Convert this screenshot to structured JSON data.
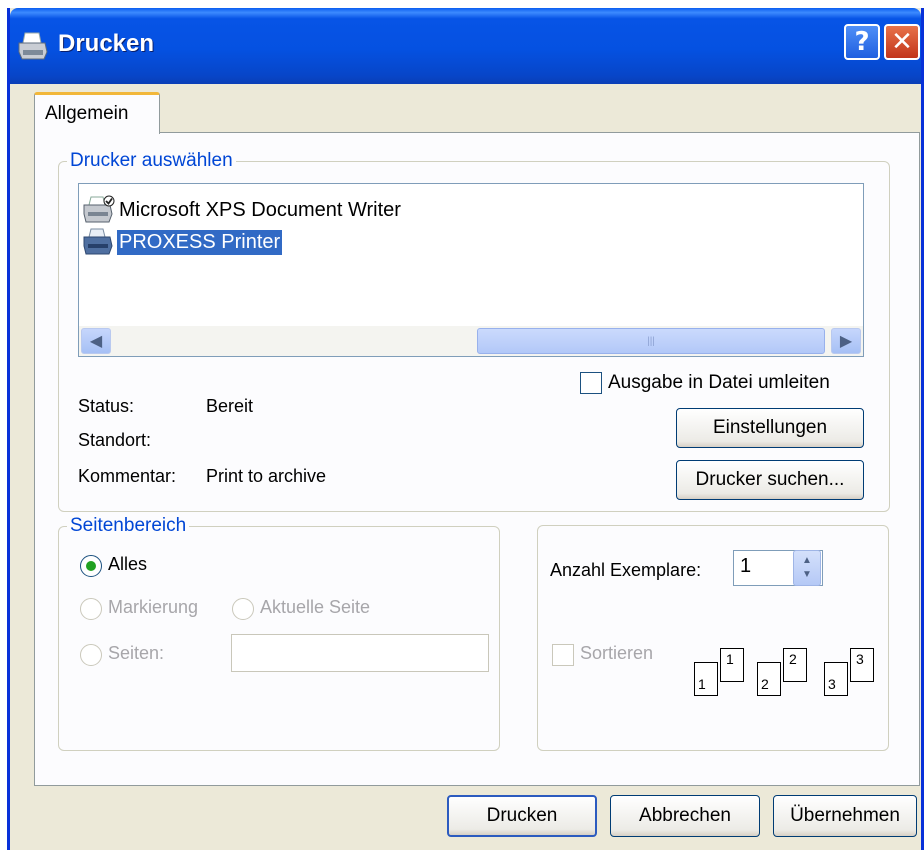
{
  "window": {
    "title": "Drucken",
    "help_button": "?",
    "close_button": "✕"
  },
  "tabs": [
    {
      "label": "Allgemein",
      "selected": true
    }
  ],
  "printer_group": {
    "legend": "Drucker auswählen",
    "printers": [
      {
        "name": "Microsoft XPS Document Writer",
        "icon": "printer-default-icon",
        "selected": false
      },
      {
        "name": "PROXESS Printer",
        "icon": "printer-icon",
        "selected": true
      }
    ],
    "scrollbar": {
      "left_arrow": "◀",
      "right_arrow": "▶",
      "thumb_grip": "|||"
    },
    "output_to_file_label": "Ausgabe in Datei umleiten",
    "output_to_file_checked": false,
    "status_label": "Status:",
    "status_value": "Bereit",
    "location_label": "Standort:",
    "location_value": "",
    "comment_label": "Kommentar:",
    "comment_value": "Print to archive",
    "settings_button": "Einstellungen",
    "find_printer_button": "Drucker suchen..."
  },
  "page_range": {
    "legend": "Seitenbereich",
    "all_label": "Alles",
    "selection_label": "Markierung",
    "current_page_label": "Aktuelle Seite",
    "pages_label": "Seiten:",
    "pages_value": "",
    "selected_option": "all"
  },
  "copies": {
    "count_label": "Anzahl Exemplare:",
    "count_value": "1",
    "collate_label": "Sortieren",
    "collate_checked": false,
    "collate_sets": [
      {
        "back": "1",
        "front": "1"
      },
      {
        "back": "2",
        "front": "2"
      },
      {
        "back": "3",
        "front": "3"
      }
    ]
  },
  "buttons": {
    "print": "Drucken",
    "cancel": "Abbrechen",
    "apply": "Übernehmen"
  },
  "colors": {
    "titlebar": "#0551e1",
    "dialog_bg": "#ece9d8",
    "selection": "#316ac5",
    "group_legend": "#0046d5"
  }
}
